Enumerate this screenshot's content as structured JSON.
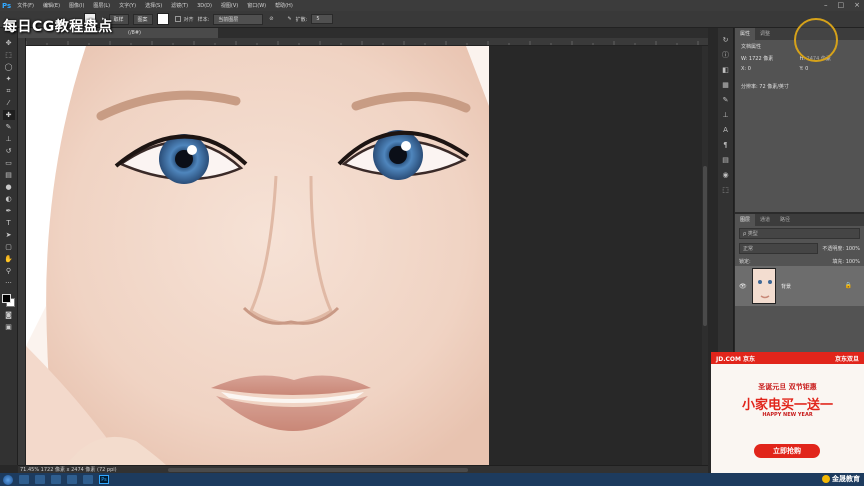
{
  "menu": {
    "logo": "Ps",
    "items": [
      "文件(F)",
      "编辑(E)",
      "图像(I)",
      "图层(L)",
      "文字(Y)",
      "选择(S)",
      "滤镜(T)",
      "3D(D)",
      "视图(V)",
      "窗口(W)",
      "帮助(H)"
    ]
  },
  "options": {
    "btn1": "取样",
    "btn2": "图案",
    "align_label": "对齐",
    "sample_label": "样本:",
    "sample_value": "当前图层",
    "diffuse_label": "扩散:",
    "diffuse_value": "5"
  },
  "watermark": {
    "left_text": "每日CG教程盘点"
  },
  "doc": {
    "tab": "(/8#)"
  },
  "status": {
    "text": "71.45%   1722 像素 x 2474 像素 (72 ppi)"
  },
  "properties": {
    "tab1": "属性",
    "tab2": "调整",
    "doc_title": "文档属性",
    "w_label": "W: 1722 像素",
    "h_label": "H: 2474 像素",
    "x_label": "X: 0",
    "y_label": "Y: 0",
    "resolution": "分辨率: 72 像素/英寸"
  },
  "layers": {
    "tab1": "图层",
    "tab2": "通道",
    "tab3": "路径",
    "search": "ρ 类型",
    "blend": "正常",
    "opacity": "不透明度: 100%",
    "fill": "填充: 100%",
    "lock": "锁定:",
    "layer_name": "背景"
  },
  "ad": {
    "brand_left": "JD.COM 京东",
    "brand_right": "京东双旦",
    "line1": "圣诞元旦 双节钜惠",
    "line2": "小家电买一送一",
    "line3": "HAPPY NEW YEAR",
    "button": "立即抢购"
  },
  "taskbar": {
    "ps": "Ps",
    "brand": "金晟教育"
  }
}
